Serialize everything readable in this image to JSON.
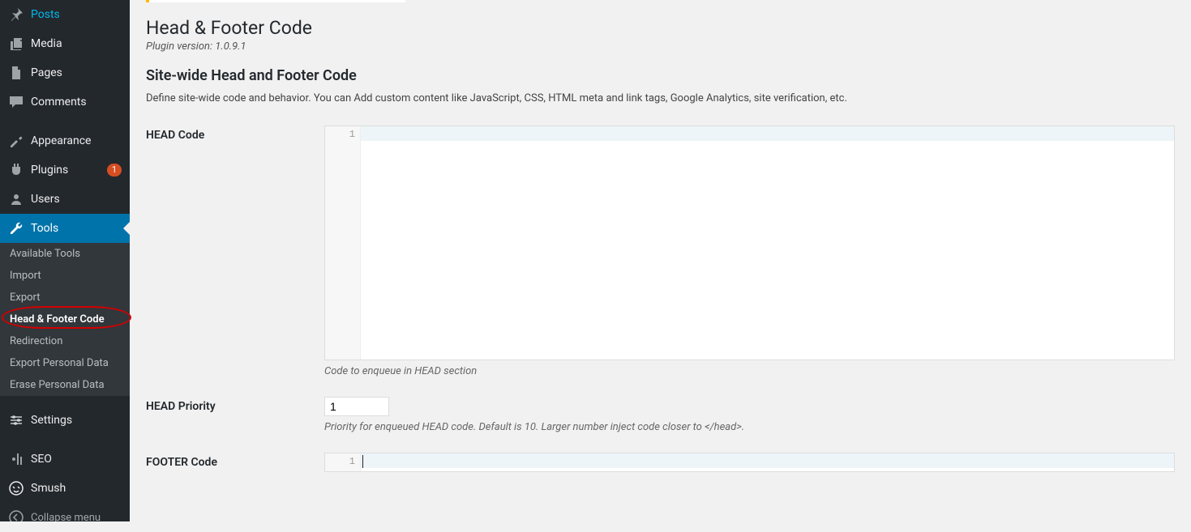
{
  "sidebar": {
    "items": [
      {
        "label": "Posts",
        "icon": "pin"
      },
      {
        "label": "Media",
        "icon": "media"
      },
      {
        "label": "Pages",
        "icon": "pages"
      },
      {
        "label": "Comments",
        "icon": "comment"
      },
      {
        "label": "Appearance",
        "icon": "appearance",
        "sep_before": true
      },
      {
        "label": "Plugins",
        "icon": "plugin",
        "badge": "1"
      },
      {
        "label": "Users",
        "icon": "users"
      },
      {
        "label": "Tools",
        "icon": "tools",
        "active": true
      },
      {
        "label": "Settings",
        "icon": "settings",
        "sep_before": true
      },
      {
        "label": "SEO",
        "icon": "seo",
        "sep_before": true
      },
      {
        "label": "Smush",
        "icon": "smush"
      }
    ],
    "submenu": [
      {
        "label": "Available Tools"
      },
      {
        "label": "Import"
      },
      {
        "label": "Export"
      },
      {
        "label": "Head & Footer Code",
        "current": true
      },
      {
        "label": "Redirection"
      },
      {
        "label": "Export Personal Data"
      },
      {
        "label": "Erase Personal Data"
      }
    ],
    "collapse": "Collapse menu"
  },
  "page": {
    "title": "Head & Footer Code",
    "version_label": "Plugin version: 1.0.9.1",
    "section_title": "Site-wide Head and Footer Code",
    "section_desc": "Define site-wide code and behavior. You can Add custom content like JavaScript, CSS, HTML meta and link tags, Google Analytics, site verification, etc.",
    "head_code_label": "HEAD Code",
    "head_code_line": "1",
    "head_code_help": "Code to enqueue in HEAD section",
    "head_priority_label": "HEAD Priority",
    "head_priority_value": "1",
    "head_priority_help": "Priority for enqueued HEAD code. Default is 10. Larger number inject code closer to </head>.",
    "footer_code_label": "FOOTER Code",
    "footer_code_line": "1"
  }
}
